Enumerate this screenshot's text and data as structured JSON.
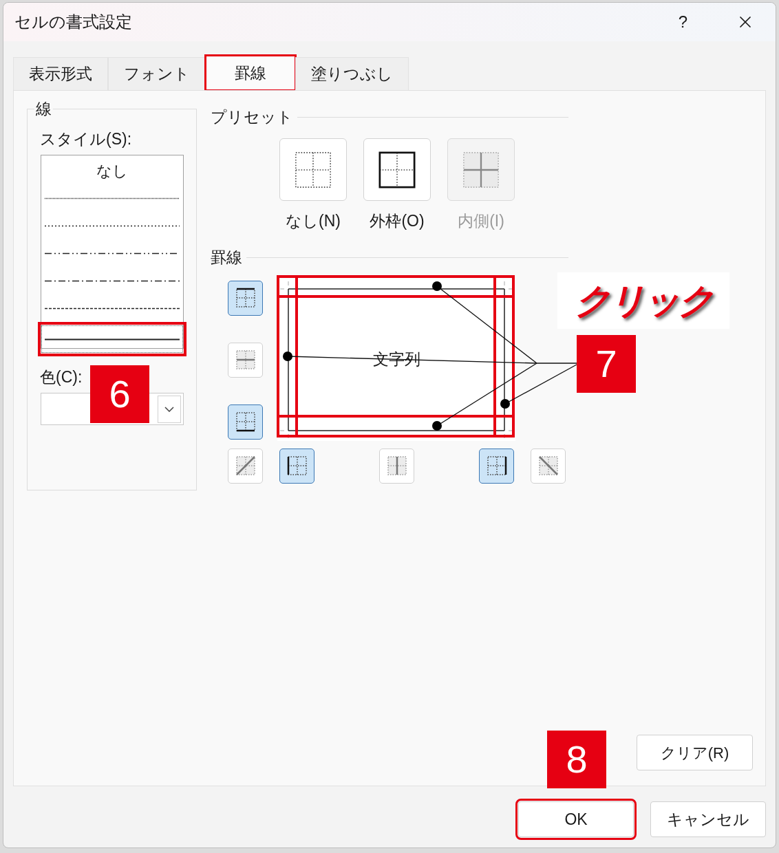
{
  "window": {
    "title": "セルの書式設定",
    "help": "?"
  },
  "tabs": [
    {
      "label": "表示形式",
      "selected": false,
      "highlighted": false
    },
    {
      "label": "フォント",
      "selected": false,
      "highlighted": false
    },
    {
      "label": "罫線",
      "selected": true,
      "highlighted": true
    },
    {
      "label": "塗りつぶし",
      "selected": false,
      "highlighted": false
    }
  ],
  "line_group": {
    "title": "線",
    "style_label": "スタイル(S):",
    "styles": [
      {
        "kind": "none",
        "label": "なし",
        "selected": false,
        "highlighted": false
      },
      {
        "kind": "hair",
        "selected": false,
        "highlighted": false
      },
      {
        "kind": "dotted",
        "selected": false,
        "highlighted": false
      },
      {
        "kind": "dash_dot_dot",
        "selected": false,
        "highlighted": false
      },
      {
        "kind": "dash_dot",
        "selected": false,
        "highlighted": false
      },
      {
        "kind": "dashed",
        "selected": false,
        "highlighted": false
      },
      {
        "kind": "thin",
        "selected": true,
        "highlighted": true
      }
    ],
    "color_label": "色(C):"
  },
  "presets": {
    "title": "プリセット",
    "items": [
      {
        "kind": "none",
        "label": "なし(N)",
        "disabled": false
      },
      {
        "kind": "outline",
        "label": "外枠(O)",
        "disabled": false
      },
      {
        "kind": "inside",
        "label": "内側(I)",
        "disabled": true
      }
    ]
  },
  "border": {
    "title": "罫線",
    "preview_text": "文字列",
    "side_buttons": [
      {
        "kind": "top",
        "selected": true
      },
      {
        "kind": "middle_h",
        "selected": false
      },
      {
        "kind": "bottom",
        "selected": true
      }
    ],
    "bottom_buttons": [
      {
        "kind": "diag_up",
        "selected": false
      },
      {
        "kind": "left",
        "selected": true
      },
      {
        "kind": "middle_v",
        "selected": false
      },
      {
        "kind": "right",
        "selected": true
      },
      {
        "kind": "diag_down",
        "selected": false
      }
    ]
  },
  "clear_button": "クリア(R)",
  "buttons": [
    {
      "label": "OK",
      "highlighted": true
    },
    {
      "label": "キャンセル",
      "highlighted": false
    }
  ],
  "annotations": {
    "click_label": "クリック",
    "badges": [
      "6",
      "7",
      "8"
    ]
  }
}
